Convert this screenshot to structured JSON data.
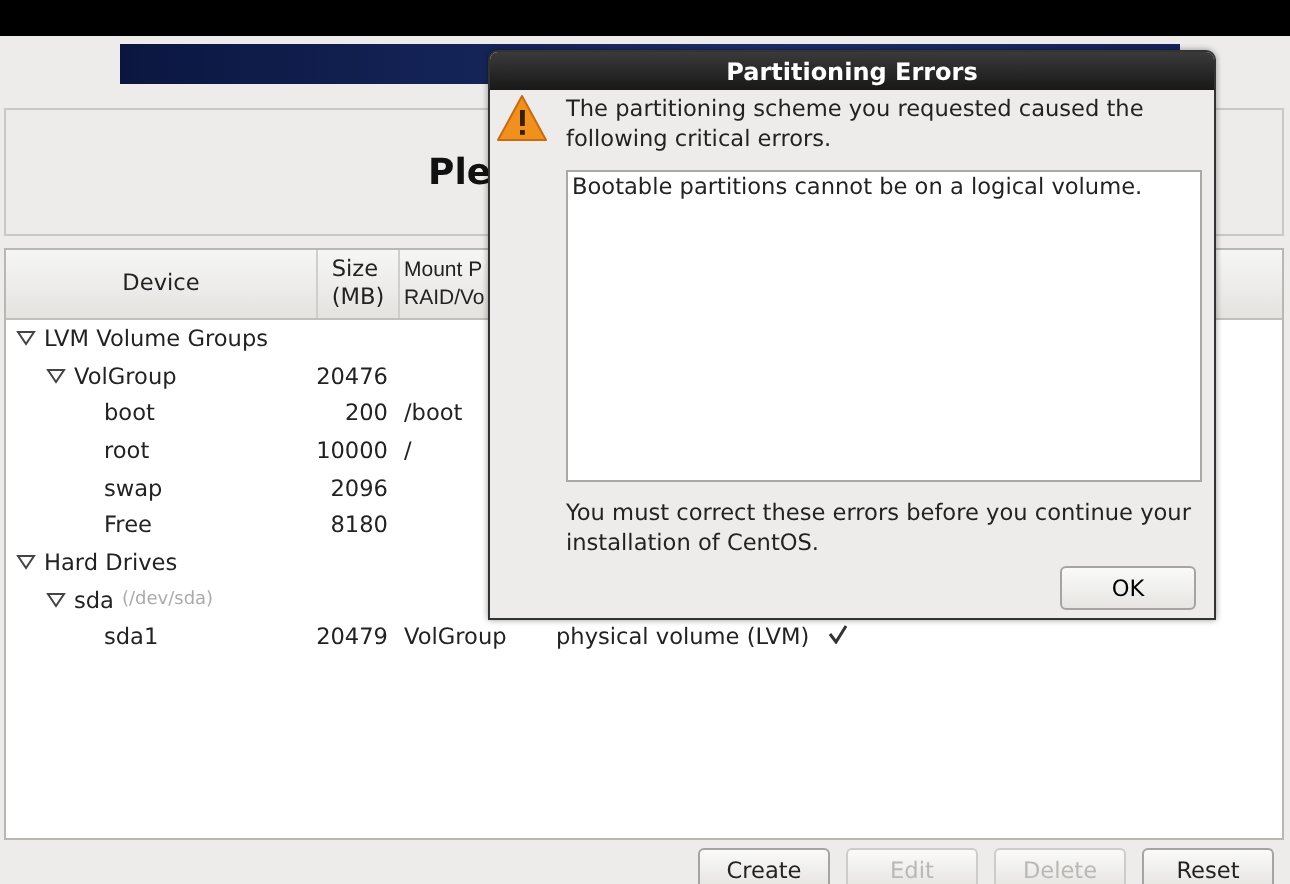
{
  "heading": "Ple",
  "table": {
    "columns": [
      "Device",
      "Size\n(MB)",
      "Mount P\nRAID/Vo"
    ],
    "rows": [
      {
        "device": "LVM Volume Groups",
        "expanded": true,
        "children": [
          {
            "device": "VolGroup",
            "size": "20476",
            "expanded": true,
            "children": [
              {
                "device": "boot",
                "size": "200",
                "mount": "/boot"
              },
              {
                "device": "root",
                "size": "10000",
                "mount": "/"
              },
              {
                "device": "swap",
                "size": "2096"
              },
              {
                "device": "Free",
                "size": "8180"
              }
            ]
          }
        ]
      },
      {
        "device": "Hard Drives",
        "expanded": true,
        "children": [
          {
            "device": "sda",
            "note": "(/dev/sda)",
            "expanded": true,
            "children": [
              {
                "device": "sda1",
                "size": "20479",
                "mount": "VolGroup",
                "type": "physical volume (LVM)",
                "format": true
              }
            ]
          }
        ]
      }
    ]
  },
  "buttons": [
    {
      "label": "Create",
      "disabled": false
    },
    {
      "label": "Edit",
      "disabled": true
    },
    {
      "label": "Delete",
      "disabled": true
    },
    {
      "label": "Reset",
      "disabled": false
    }
  ],
  "dialog": {
    "title": "Partitioning Errors",
    "message": "The partitioning scheme you requested caused the following critical errors.",
    "errors": "Bootable partitions cannot be on a logical volume.",
    "footer": "You must correct these errors before you continue your installation of CentOS.",
    "button": "OK"
  }
}
